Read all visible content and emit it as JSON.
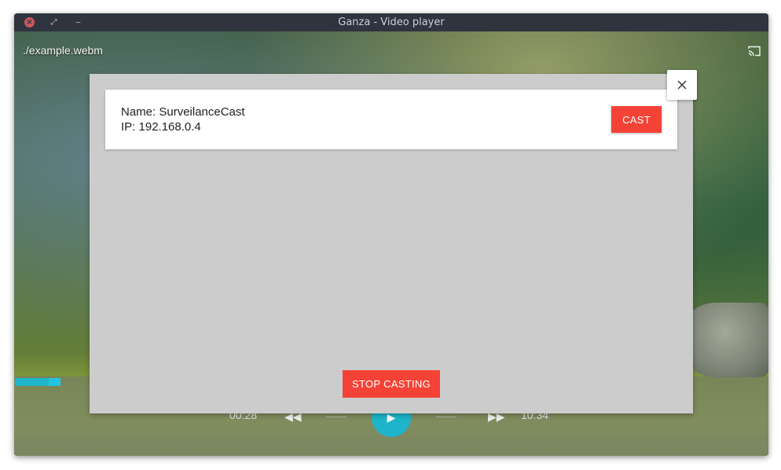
{
  "window": {
    "title": "Ganza - Video player"
  },
  "player": {
    "filename": "./example.webm",
    "current_time": "00:28",
    "total_time": "10:34",
    "progress": 0.06
  },
  "dialog": {
    "device": {
      "name_line": "Name: SurveilanceCast",
      "ip_line": "IP: 192.168.0.4",
      "cast_label": "CAST"
    },
    "stop_label": "STOP CASTING"
  },
  "colors": {
    "accent_red": "#f44336",
    "accent_teal": "#1eb4c9",
    "titlebar": "#2f343f"
  },
  "icons": [
    "window-close-icon",
    "window-maximize-icon",
    "window-minimize-icon",
    "cast-icon",
    "rewind-icon",
    "play-icon",
    "fast-forward-icon",
    "dialog-close-icon"
  ]
}
